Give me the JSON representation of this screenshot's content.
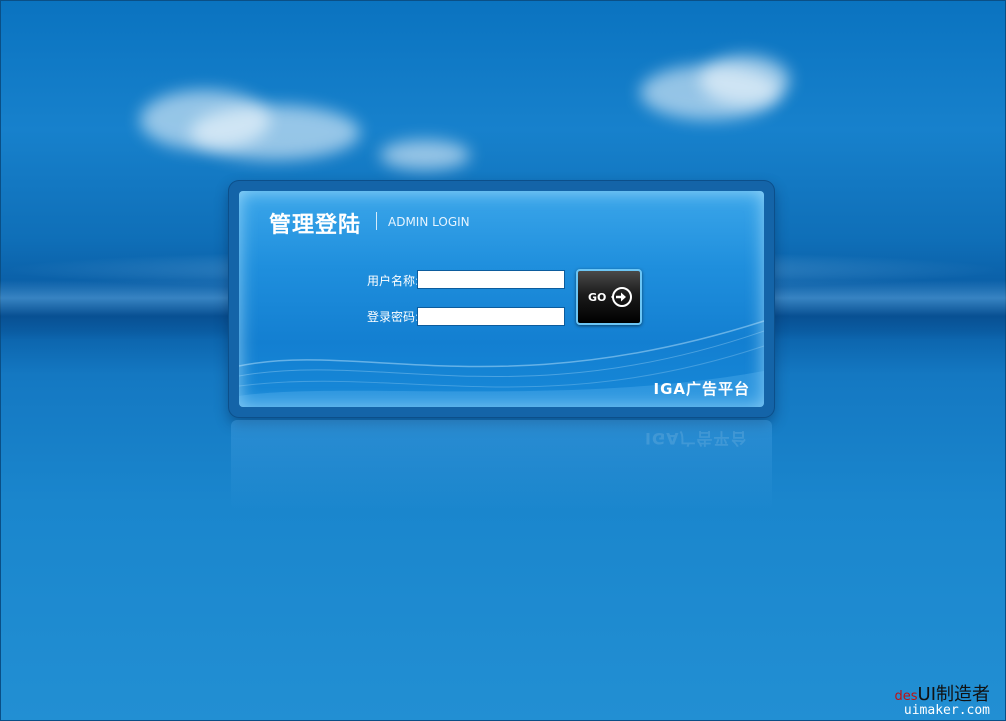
{
  "login": {
    "title": "管理登陆",
    "subtitle": "ADMIN LOGIN",
    "username_label": "用户名称:",
    "username_value": "",
    "password_label": "登录密码:",
    "password_value": "",
    "go_label": "GO"
  },
  "brand": "IGA广告平台",
  "watermark": {
    "prefix": "des",
    "main": "UI制造者",
    "url": "uimaker.com"
  },
  "colors": {
    "background": "#1781cc",
    "panel": "#1f8fdd",
    "button": "#000000",
    "button_border": "#6cc6f5"
  },
  "icons": {
    "go": "arrow-circle-right-icon"
  }
}
